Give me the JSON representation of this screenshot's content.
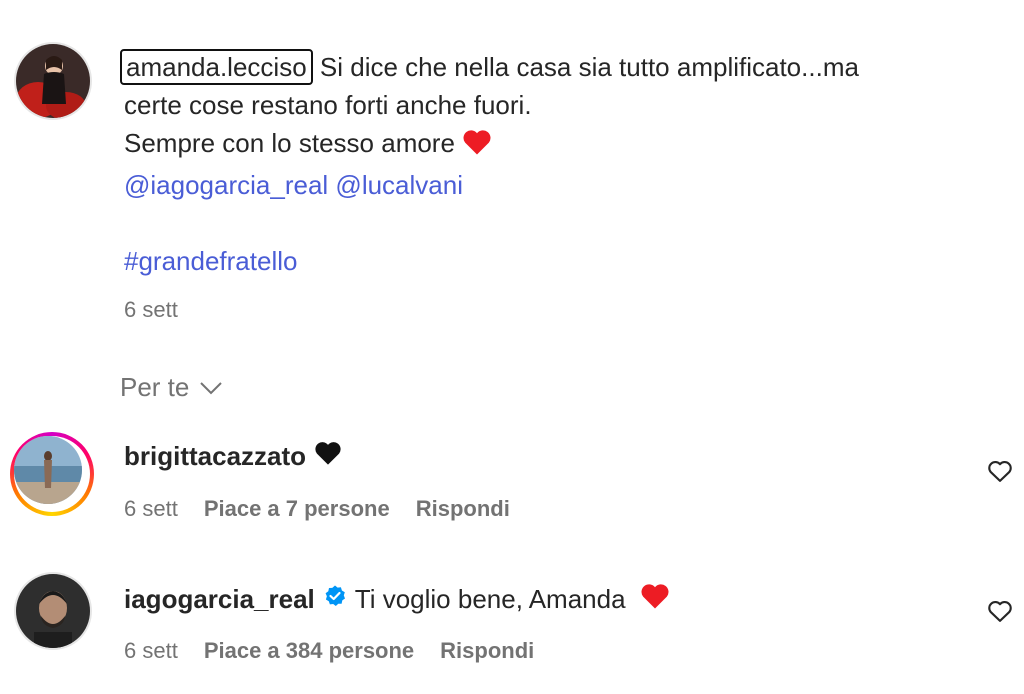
{
  "caption": {
    "username": "amanda.lecciso",
    "line1": "Si dice che nella casa sia tutto amplificato...ma",
    "line2": "certe cose restano forti anche fuori.",
    "line3": "Sempre con lo stesso amore",
    "mention1": "@iagogarcia_real",
    "mention2": "@lucalvani",
    "hashtag": "#grandefratello",
    "time": "6 sett"
  },
  "sort": {
    "label": "Per te"
  },
  "comments": [
    {
      "username": "brigittacazzato",
      "text": "",
      "time": "6 sett",
      "likes": "Piace a 7 persone",
      "reply": "Rispondi",
      "verified": false
    },
    {
      "username": "iagogarcia_real",
      "text": "Ti voglio bene, Amanda",
      "time": "6 sett",
      "likes": "Piace a 384 persone",
      "reply": "Rispondi",
      "verified": true
    }
  ],
  "colors": {
    "link": "#4a5dd6",
    "heart_red": "#ed1c24",
    "verified": "#0095f6",
    "muted": "#737373"
  },
  "icons": [
    "red-heart-icon",
    "black-heart-icon",
    "chevron-down-icon",
    "verified-badge-icon",
    "like-heart-icon"
  ]
}
